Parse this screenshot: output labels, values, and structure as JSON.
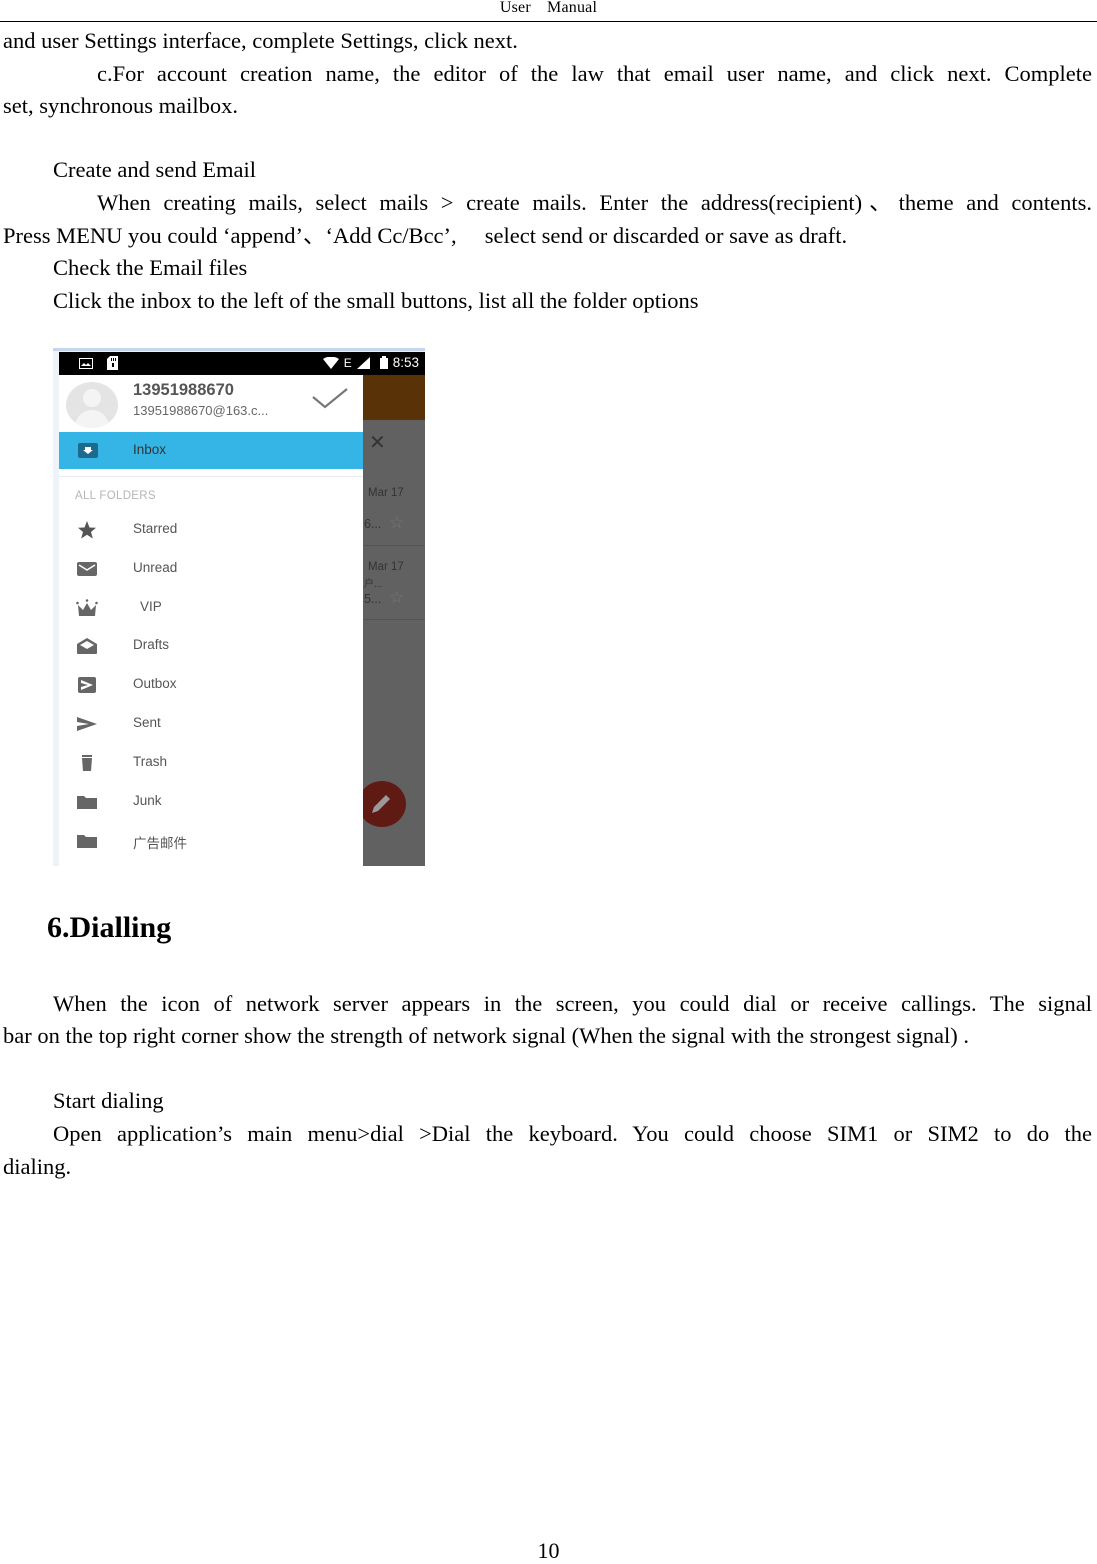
{
  "header": {
    "title": "User Manual"
  },
  "paragraphs": [
    "and user Settings interface, complete Settings, click next.",
    "c.For account creation name, the editor of the law that email user name, and click next. Complete",
    "set, synchronous mailbox.",
    "Create and send Email",
    "When creating mails, select mails > create mails. Enter the address(recipient)、theme and contents.",
    "Press MENU you could ‘append’、‘Add Cc/Bcc’,  select send or discarded or save as draft.",
    "Check the Email files",
    "Click the inbox to the left of the small buttons, list all the folder options"
  ],
  "screenshot": {
    "status_bar": {
      "network": "E",
      "time": "8:53",
      "icons": [
        "image-icon",
        "sd-card-icon",
        "wifi-icon",
        "signal-icon",
        "battery-icon"
      ]
    },
    "account": {
      "name": "13951988670",
      "email": "13951988670@163.c..."
    },
    "selected_folder": {
      "label": "Inbox",
      "icon": "inbox-icon",
      "color": "#35b5e5"
    },
    "section_label": "ALL FOLDERS",
    "folders": [
      {
        "label": "Starred",
        "icon": "star-icon"
      },
      {
        "label": "Unread",
        "icon": "envelope-icon"
      },
      {
        "label": "VIP",
        "icon": "crown-icon"
      },
      {
        "label": "Drafts",
        "icon": "drafts-icon"
      },
      {
        "label": "Outbox",
        "icon": "outbox-icon"
      },
      {
        "label": "Sent",
        "icon": "send-icon"
      },
      {
        "label": "Trash",
        "icon": "trash-icon"
      },
      {
        "label": "Junk",
        "icon": "folder-icon"
      },
      {
        "label": "广告邮件",
        "icon": "folder-icon"
      }
    ],
    "background_list": [
      {
        "date": "Mar 17",
        "snippet": "6...",
        "extra": ""
      },
      {
        "date": "Mar 17",
        "snippet": "5...",
        "extra": "户..."
      }
    ],
    "appbar_color": "#5a3208",
    "fab_color": "#601a14"
  },
  "section": {
    "heading": "6.Dialling",
    "paragraphs": [
      "When the icon of network server appears in the screen, you could dial or receive callings. The signal",
      "bar on the top right corner show the strength of network signal (When the signal with the strongest signal) .",
      "Start dialing",
      "Open application’s main menu>dial >Dial the keyboard. You could choose SIM1 or SIM2 to do the",
      "dialing."
    ]
  },
  "footer": {
    "page_number": "10"
  }
}
